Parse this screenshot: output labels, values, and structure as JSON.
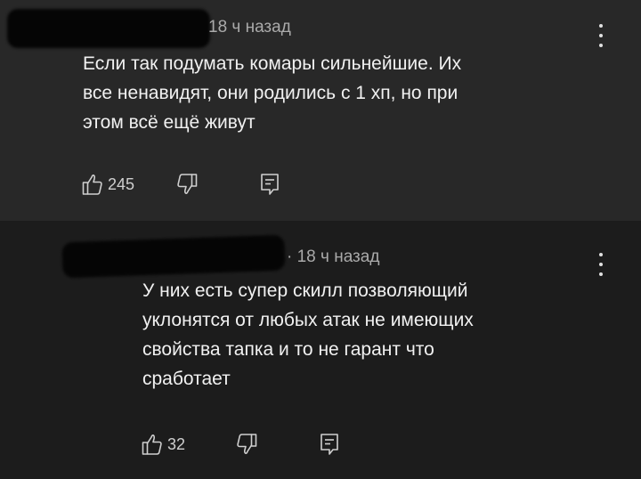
{
  "comments": [
    {
      "time": "18 ч назад",
      "text_lines": [
        "Если так подумать комары сильнейшие. Их",
        "все ненавидят, они родились с 1 хп, но при",
        "этом всё ещё живут"
      ],
      "likes": "245",
      "icons": [
        "like-icon",
        "dislike-icon",
        "reply-icon",
        "more-vertical-icon"
      ]
    },
    {
      "time_prefix": "·",
      "time": "18 ч назад",
      "text_lines": [
        "У них есть супер скилл позволяющий",
        "уклонятся от любых атак не имеющих",
        "свойства тапка и то не гарант что",
        "сработает"
      ],
      "likes": "32",
      "icons": [
        "like-icon",
        "dislike-icon",
        "reply-icon",
        "more-vertical-icon"
      ]
    }
  ],
  "colors": {
    "comment1_bg": "#282828",
    "comment2_bg": "#1c1c1c",
    "text": "#f1f1f1",
    "meta": "#aaaaaa"
  }
}
